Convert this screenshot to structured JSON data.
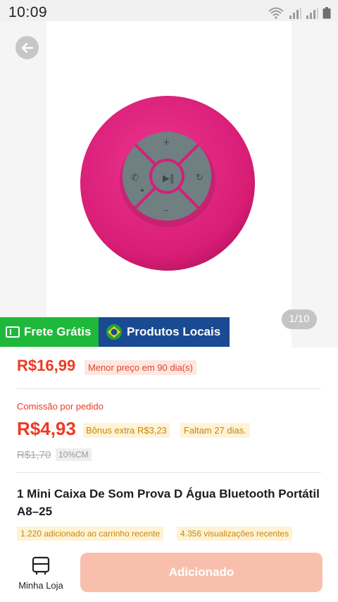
{
  "status_bar": {
    "time": "10:09",
    "icons": [
      "wifi-icon",
      "signal-icon",
      "signal-icon",
      "battery-icon"
    ]
  },
  "gallery": {
    "counter": "1/10",
    "back_icon": "arrow-left-icon"
  },
  "badges": {
    "free_shipping": "Frete Grátis",
    "local_products": "Produtos Locais"
  },
  "price": {
    "current": "R$16,99",
    "lowest_label": "Menor preço em 90 dia(s)"
  },
  "commission": {
    "label": "Comissão por pedido",
    "value": "R$4,93",
    "bonus": "Bônus extra R$3,23",
    "days_left": "Faltam 27 dias.",
    "old_value": "R$1,70",
    "rate": "10%CM"
  },
  "product": {
    "title": "1 Mini Caixa De Som Prova D Água Bluetooth Portátil A8–25",
    "cart_adds": "1.220 adicionado ao carrinho recente",
    "views": "4.356 visualizações recentes"
  },
  "bottom_bar": {
    "store_label": "Minha Loja",
    "added_label": "Adicionado"
  },
  "colors": {
    "price_red": "#ee3a24",
    "free_green": "#1fb83a",
    "local_blue": "#1a4b92",
    "speaker_pink": "#e0237d",
    "speaker_gray": "#6f7e80",
    "button_disabled": "#f8c0ac"
  }
}
